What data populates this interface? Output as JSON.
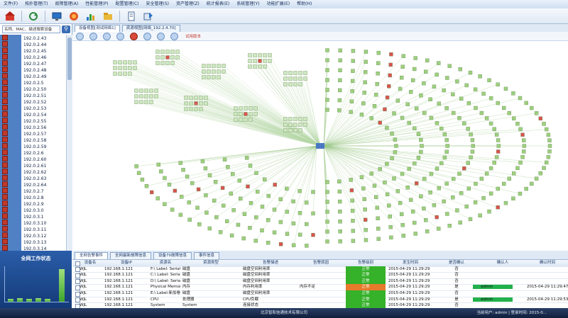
{
  "menu": [
    "文件(F)",
    "拓扑管理(T)",
    "故障管理(A)",
    "性能管理(P)",
    "配置管理(C)",
    "安全管理(S)",
    "资产管理(Z)",
    "统计报表(E)",
    "系统管理(Y)",
    "功能扩展(E)",
    "帮助(H)"
  ],
  "toolbar_icons": [
    "home-icon",
    "refresh-icon",
    "monitor-icon",
    "alarm-icon",
    "chart-icon",
    "folder-icon",
    "document-icon",
    "export-icon"
  ],
  "left": {
    "search_placeholder": "名称、MAC、描述搜索设备",
    "devices": [
      "192.0.2.43",
      "192.0.2.44",
      "192.0.2.45",
      "192.0.2.46",
      "192.0.2.47",
      "192.0.2.48",
      "192.0.2.49",
      "192.0.2.5",
      "192.0.2.50",
      "192.0.2.51",
      "192.0.2.52",
      "192.0.2.53",
      "192.0.2.54",
      "192.0.2.55",
      "192.0.2.56",
      "192.0.2.57",
      "192.0.2.58",
      "192.0.2.59",
      "192.0.2.6",
      "192.0.2.60",
      "192.0.2.61",
      "192.0.2.62",
      "192.0.2.63",
      "192.0.2.64",
      "192.0.2.7",
      "192.0.2.8",
      "192.0.2.9",
      "192.0.3.0",
      "192.0.3.1",
      "192.0.3.10",
      "192.0.3.11",
      "192.0.3.12",
      "192.0.3.13",
      "192.0.3.14"
    ],
    "status_title": "全网工作状态"
  },
  "tabs": [
    "设备视图[测试网络1]",
    "资源视图[网络_192.2.4.70]"
  ],
  "topo_tag": "试用版本",
  "bottom_tabs": [
    "全网告警事件",
    "全网最新故障信息",
    "设备70故障信息",
    "事件信息"
  ],
  "table": {
    "headers": [
      "设备名",
      "设备IP",
      "资源名",
      "资源类型",
      "告警描述",
      "告警原因",
      "告警级别",
      "发生时间",
      "是否确认",
      "确认人",
      "确认时间"
    ],
    "rows": [
      {
        "name": "WJL",
        "ip": "192.168.1.121",
        "res": "F:\\ Label: Serial N...",
        "type": "磁盘",
        "desc": "磁盘空间利用率",
        "reason": "",
        "level": "正常",
        "time": "2015-04-29 11:29:29",
        "confirmed": "否",
        "by": "",
        "ctime": ""
      },
      {
        "name": "WJL",
        "ip": "192.168.1.121",
        "res": "C:\\ Label: Serial N...",
        "type": "磁盘",
        "desc": "磁盘空间利用率",
        "reason": "",
        "level": "正常",
        "time": "2015-04-29 11:29:29",
        "confirmed": "否",
        "by": "",
        "ctime": ""
      },
      {
        "name": "WJL",
        "ip": "192.168.1.121",
        "res": "D:\\ Label: Serial N...",
        "type": "磁盘",
        "desc": "磁盘空间利用率",
        "reason": "",
        "level": "正常",
        "time": "2015-04-29 11:29:29",
        "confirmed": "否",
        "by": "",
        "ctime": ""
      },
      {
        "name": "WJL",
        "ip": "192.168.1.121",
        "res": "Physical Memory",
        "type": "内存",
        "desc": "内存利用率",
        "reason": "内存不足",
        "level": "正常",
        "time": "2015-04-29 11:29:29",
        "confirmed": "是",
        "by": "admin",
        "ctime": "2015-04-29 11:29:47"
      },
      {
        "name": "WJL",
        "ip": "192.168.1.121",
        "res": "E:\\ Label:新加卷 S...",
        "type": "磁盘",
        "desc": "磁盘空间利用率",
        "reason": "",
        "level": "正常",
        "time": "2015-04-29 11:29:29",
        "confirmed": "否",
        "by": "",
        "ctime": ""
      },
      {
        "name": "WJL",
        "ip": "192.168.1.121",
        "res": "CPU",
        "type": "处理器",
        "desc": "CPU负载",
        "reason": "",
        "level": "正常",
        "time": "2015-04-29 11:29:29",
        "confirmed": "是",
        "by": "admin",
        "ctime": "2015-04-29 11:29:53"
      },
      {
        "name": "WJL",
        "ip": "192.168.1.121",
        "res": "System",
        "type": "System",
        "desc": "连接状态",
        "reason": "",
        "level": "正常",
        "time": "2015-04-29 11:29:29",
        "confirmed": "否",
        "by": "",
        "ctime": ""
      }
    ]
  },
  "footer": {
    "company": "北京智和信通技术有限公司",
    "user": "当前用户: admin | 登录时间: 2015-0..."
  },
  "colors": {
    "accent": "#2a5da8",
    "normal": "#35b12a",
    "warning": "#e77a2b",
    "node": "#9ed07f"
  }
}
